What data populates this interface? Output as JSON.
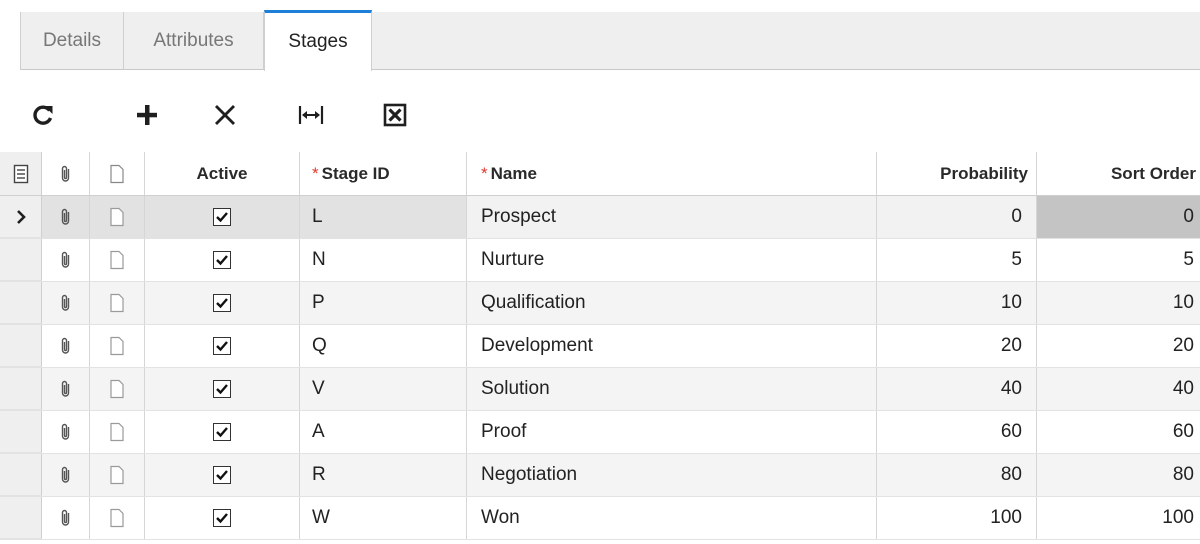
{
  "tabs": [
    {
      "label": "Details"
    },
    {
      "label": "Attributes"
    },
    {
      "label": "Stages"
    }
  ],
  "toolbar": {
    "icons": [
      "refresh-icon",
      "add-icon",
      "delete-icon",
      "fit-columns-icon",
      "export-excel-icon"
    ]
  },
  "grid": {
    "columns": {
      "active": "Active",
      "stage_id": "Stage ID",
      "name": "Name",
      "probability": "Probability",
      "sort_order": "Sort Order",
      "required_marker": "*"
    },
    "rows": [
      {
        "active": true,
        "stage_id": "L",
        "name": "Prospect",
        "probability": "0",
        "sort_order": "0"
      },
      {
        "active": true,
        "stage_id": "N",
        "name": "Nurture",
        "probability": "5",
        "sort_order": "5"
      },
      {
        "active": true,
        "stage_id": "P",
        "name": "Qualification",
        "probability": "10",
        "sort_order": "10"
      },
      {
        "active": true,
        "stage_id": "Q",
        "name": "Development",
        "probability": "20",
        "sort_order": "20"
      },
      {
        "active": true,
        "stage_id": "V",
        "name": "Solution",
        "probability": "40",
        "sort_order": "40"
      },
      {
        "active": true,
        "stage_id": "A",
        "name": "Proof",
        "probability": "60",
        "sort_order": "60"
      },
      {
        "active": true,
        "stage_id": "R",
        "name": "Negotiation",
        "probability": "80",
        "sort_order": "80"
      },
      {
        "active": true,
        "stage_id": "W",
        "name": "Won",
        "probability": "100",
        "sort_order": "100"
      }
    ]
  },
  "colors": {
    "active_tab_accent": "#1e7fd8",
    "required_marker": "#e0392d"
  }
}
